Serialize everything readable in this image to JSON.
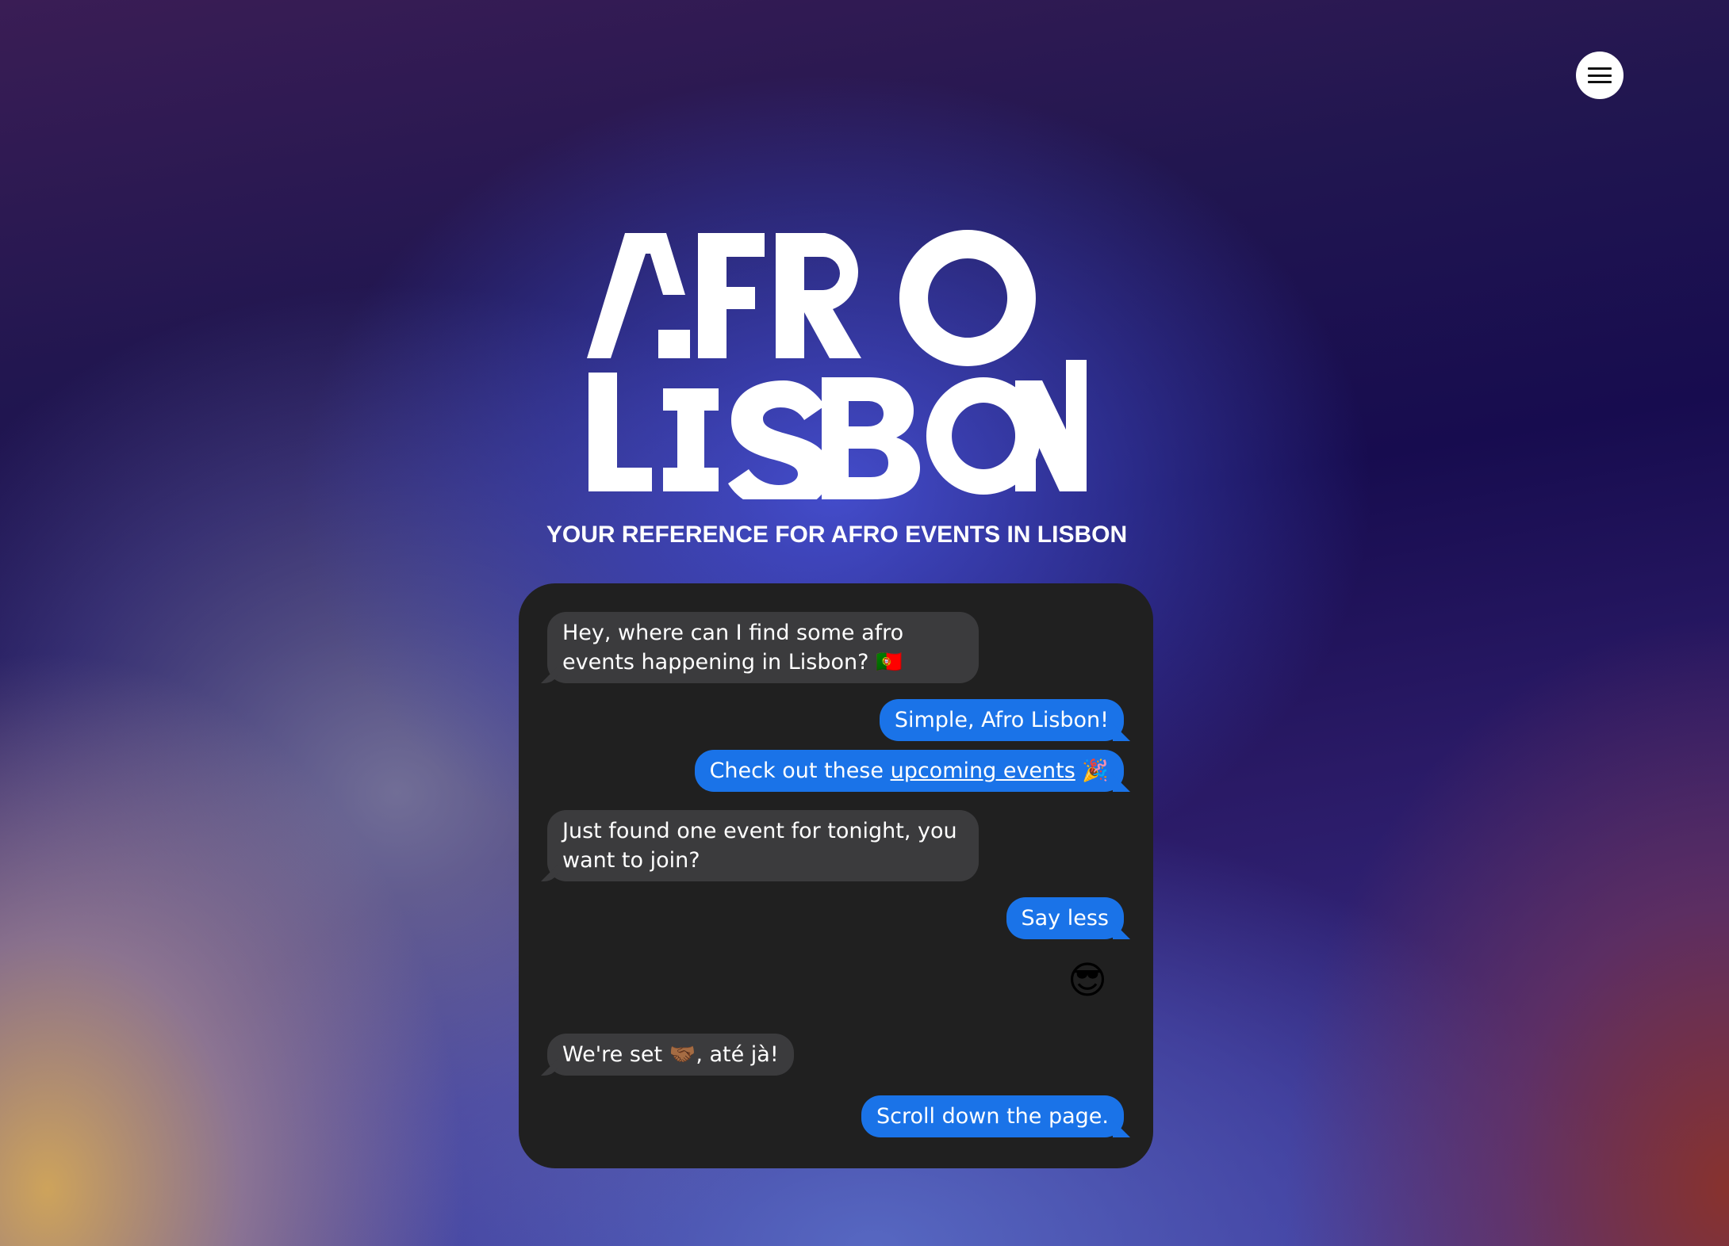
{
  "header": {
    "menu_icon": "hamburger-menu-icon"
  },
  "logo": {
    "line1": "AFRO",
    "line2": "LISBON"
  },
  "tagline": "YOUR REFERENCE FOR AFRO EVENTS IN LISBON",
  "chat": {
    "messages": [
      {
        "from": "in",
        "text": "Hey, where can I find some afro events happening in Lisbon? 🇵🇹"
      },
      {
        "from": "out",
        "text": "Simple, Afro Lisbon!"
      },
      {
        "from": "out",
        "prefix": "Check out these ",
        "link": "upcoming events",
        "suffix": " 🎉"
      },
      {
        "from": "in",
        "text": "Just found one event for tonight, you want to join?"
      },
      {
        "from": "out",
        "text": "Say less"
      },
      {
        "from": "out",
        "emoji": "😎",
        "emoji_name": "sunglasses-face-emoji"
      },
      {
        "from": "in",
        "text": "We're set 🤝🏾, até jà!"
      },
      {
        "from": "out",
        "text": "Scroll down the page."
      }
    ]
  },
  "colors": {
    "bubble_incoming": "#3b3b3d",
    "bubble_outgoing": "#1a73e8",
    "chat_background": "#202020"
  }
}
